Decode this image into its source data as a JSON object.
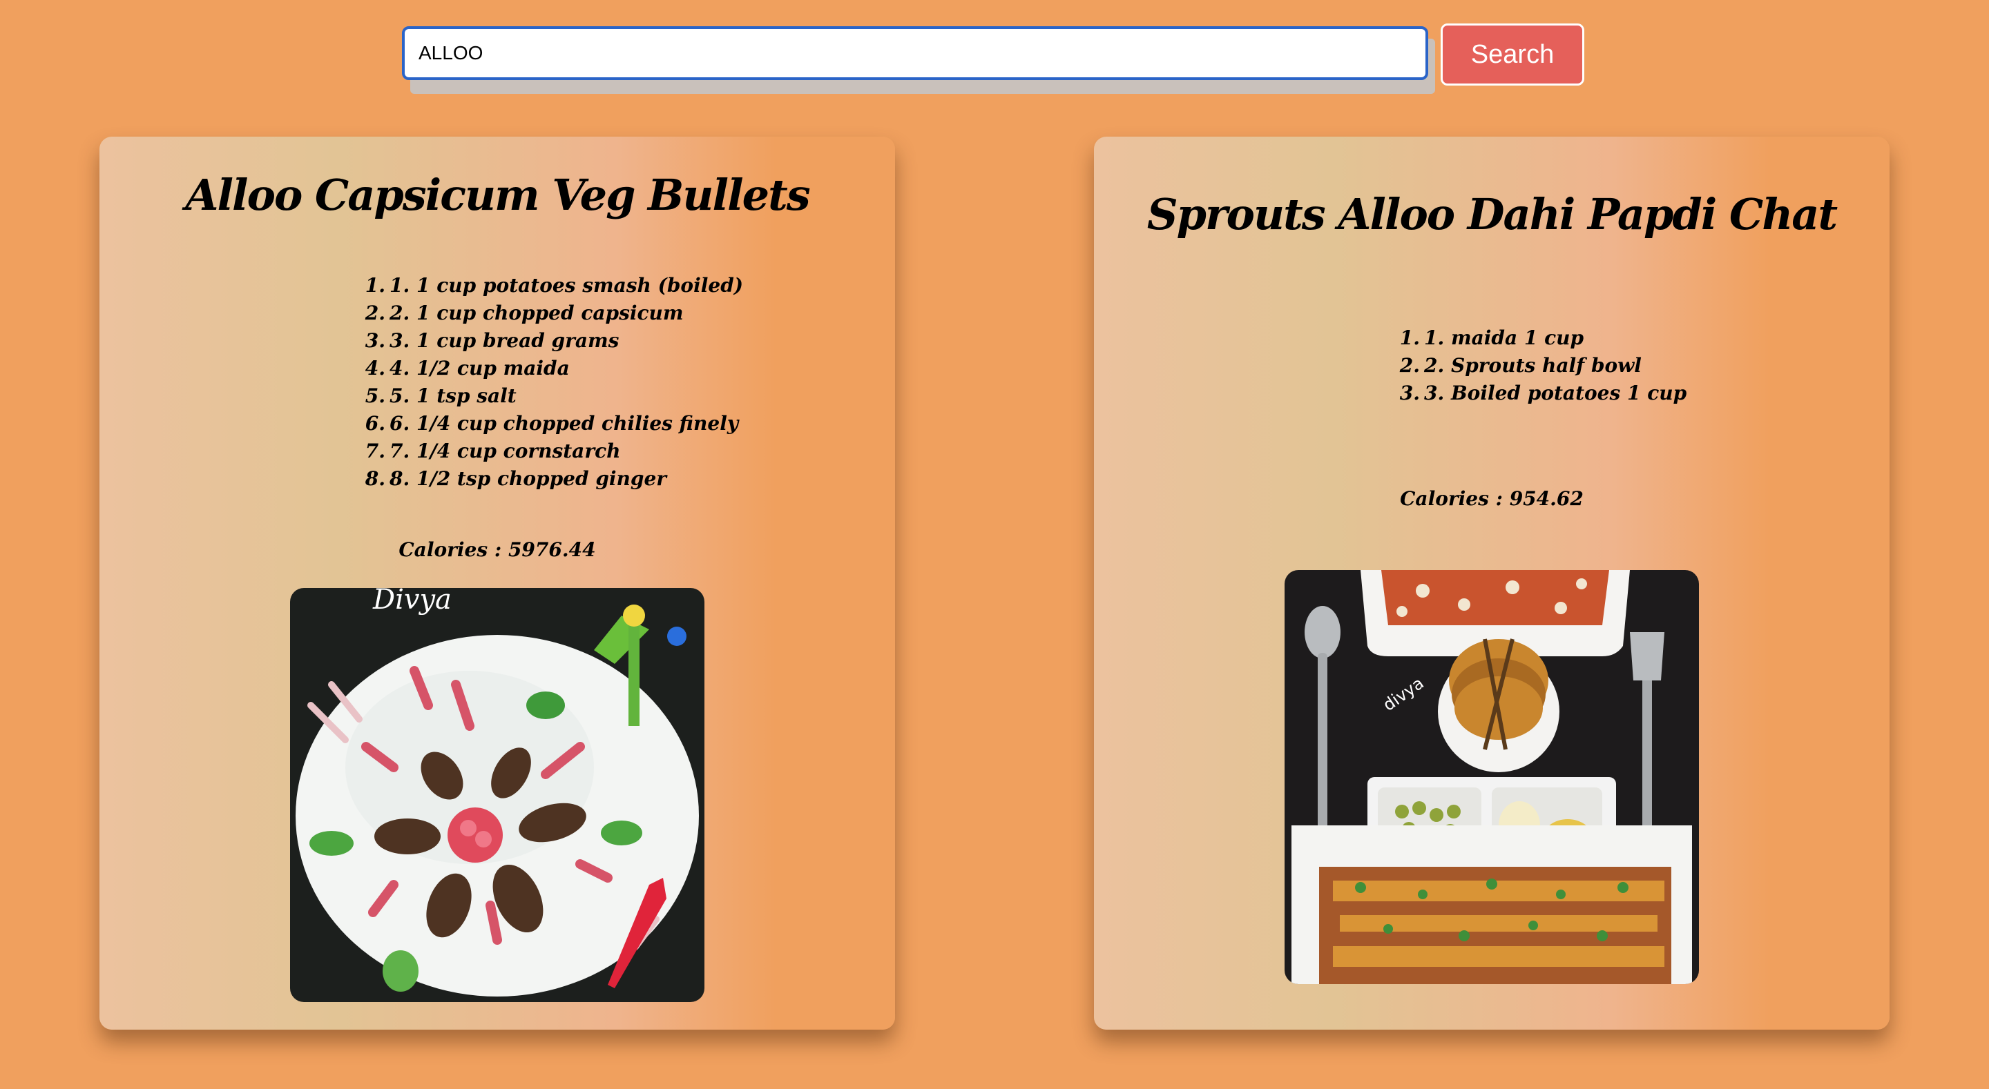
{
  "search": {
    "value": "ALLOO",
    "button_label": "Search"
  },
  "recipes": [
    {
      "title": "Alloo Capsicum Veg Bullets",
      "ingredients": [
        {
          "number": "1.",
          "text": "1. 1 cup potatoes smash (boiled)"
        },
        {
          "number": "2.",
          "text": "2. 1 cup chopped capsicum"
        },
        {
          "number": "3.",
          "text": "3. 1 cup bread grams"
        },
        {
          "number": "4.",
          "text": "4. 1/2 cup maida"
        },
        {
          "number": "5.",
          "text": "5. 1 tsp salt"
        },
        {
          "number": "6.",
          "text": "6. 1/4 cup chopped chilies finely"
        },
        {
          "number": "7.",
          "text": "7. 1/4 cup cornstarch"
        },
        {
          "number": "8.",
          "text": "8. 1/2 tsp chopped ginger"
        }
      ],
      "calories_label": "Calories : ",
      "calories_value": "5976.44",
      "image_watermark": "Divya"
    },
    {
      "title": "Sprouts Alloo Dahi Papdi Chat",
      "ingredients": [
        {
          "number": "1.",
          "text": "1. maida 1 cup"
        },
        {
          "number": "2.",
          "text": "2. Sprouts half bowl"
        },
        {
          "number": "3.",
          "text": "3. Boiled potatoes 1 cup"
        }
      ],
      "calories_label": "Calories : ",
      "calories_value": "954.62",
      "image_watermark": "divya"
    }
  ]
}
